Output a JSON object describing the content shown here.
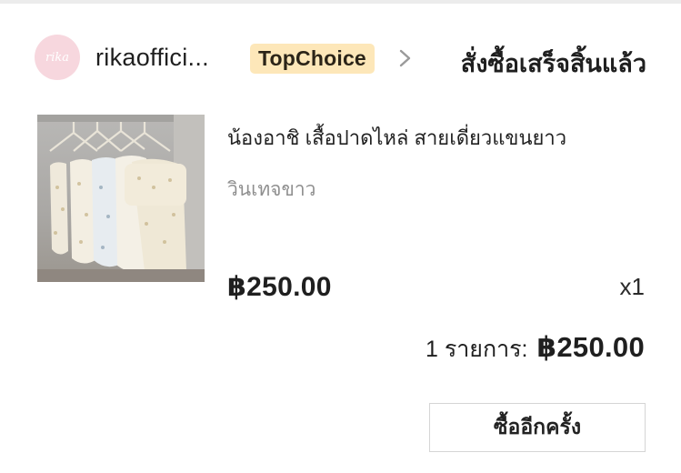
{
  "shop": {
    "avatar_text": "rika",
    "name": "rikaoffici...",
    "badge": "TopChoice",
    "chevron_icon": "chevron-right-icon"
  },
  "order": {
    "status": "สั่งซื้อเสร็จสิ้นแล้ว"
  },
  "product": {
    "image_icon": "product-photo-blouses-on-hangers",
    "title": "น้องอาชิ เสื้อปาดไหล่ สายเดี่ยวแขนยาว",
    "variant": "วินเทจขาว",
    "price": "฿250.00",
    "quantity": "x1"
  },
  "summary": {
    "label": "1 รายการ:",
    "total": "฿250.00"
  },
  "actions": {
    "rebuy_label": "ซื้ออีกครั้ง"
  },
  "colors": {
    "badge_bg": "#fde7b9",
    "avatar_bg": "#f7d7de",
    "variant_text": "#8f8f8f",
    "button_border": "#d5d5d5"
  }
}
